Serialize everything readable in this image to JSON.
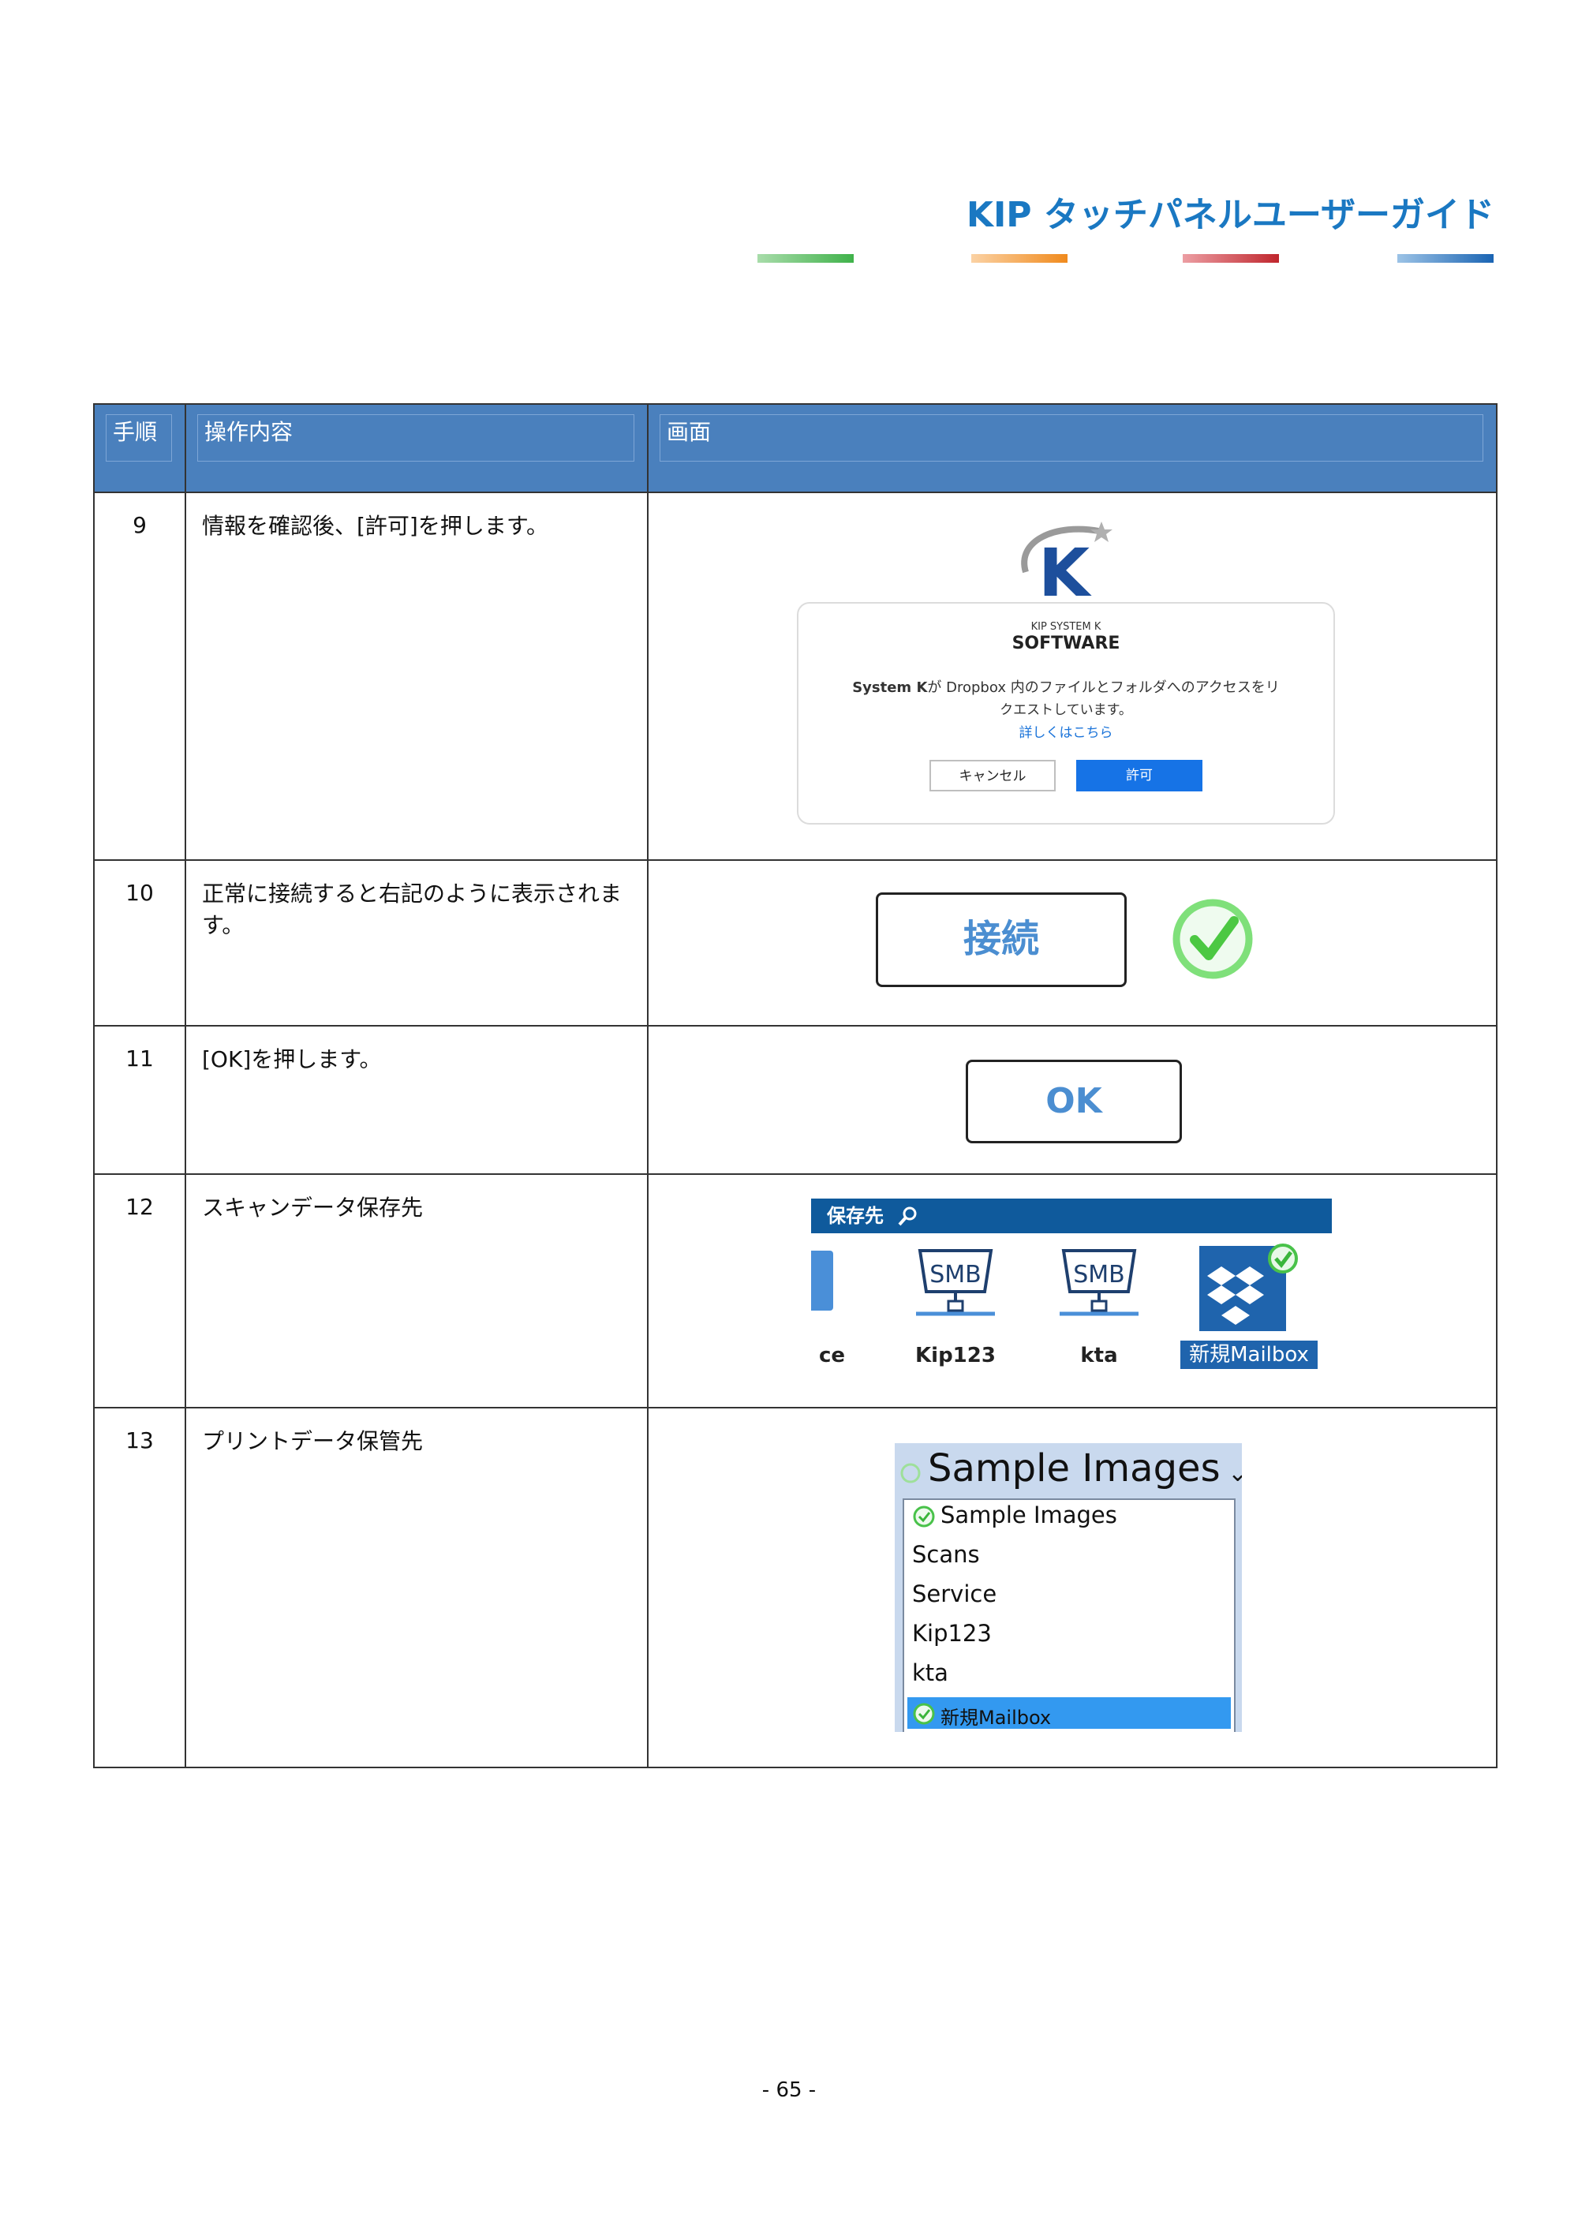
{
  "header": {
    "title": "KIP タッチパネルユーザーガイド",
    "accent_colors": [
      "#3fb24a",
      "#f08a1d",
      "#c0262d",
      "#1a64b3"
    ]
  },
  "table": {
    "headers": {
      "step": "手順",
      "operation": "操作内容",
      "screen": "画面"
    },
    "rows": [
      {
        "step": "9",
        "operation": "情報を確認後、[許可]を押します。"
      },
      {
        "step": "10",
        "operation": "正常に接続すると右記のように表示されます。"
      },
      {
        "step": "11",
        "operation": "[OK]を押します。"
      },
      {
        "step": "12",
        "operation": "スキャンデータ保存先"
      },
      {
        "step": "13",
        "operation": "プリントデータ保管先"
      }
    ]
  },
  "dialog": {
    "logo_line1": "KIP SYSTEM K",
    "logo_line2": "SOFTWARE",
    "message_strong": "System K",
    "message_line1": "が Dropbox 内のファイルとフォルダへのアクセスをリ",
    "message_line2": "クエストしています。",
    "link": "詳しくはこちら",
    "cancel_label": "キャンセル",
    "allow_label": "許可"
  },
  "connect": {
    "label": "接続"
  },
  "ok": {
    "label": "OK"
  },
  "destinations": {
    "header": "保存先",
    "items": [
      {
        "label": "ce",
        "icon": "folder-icon"
      },
      {
        "label": "Kip123",
        "icon": "smb-folder-icon"
      },
      {
        "label": "kta",
        "icon": "smb-folder-icon"
      },
      {
        "label": "新規Mailbox",
        "icon": "dropbox-icon",
        "selected": true
      }
    ]
  },
  "sample": {
    "current": "Sample Images",
    "options": [
      "Sample Images",
      "Scans",
      "Service",
      "Kip123",
      "kta",
      "新規Mailbox"
    ],
    "selected": "新規Mailbox"
  },
  "footer": {
    "page": "- 65 -"
  }
}
